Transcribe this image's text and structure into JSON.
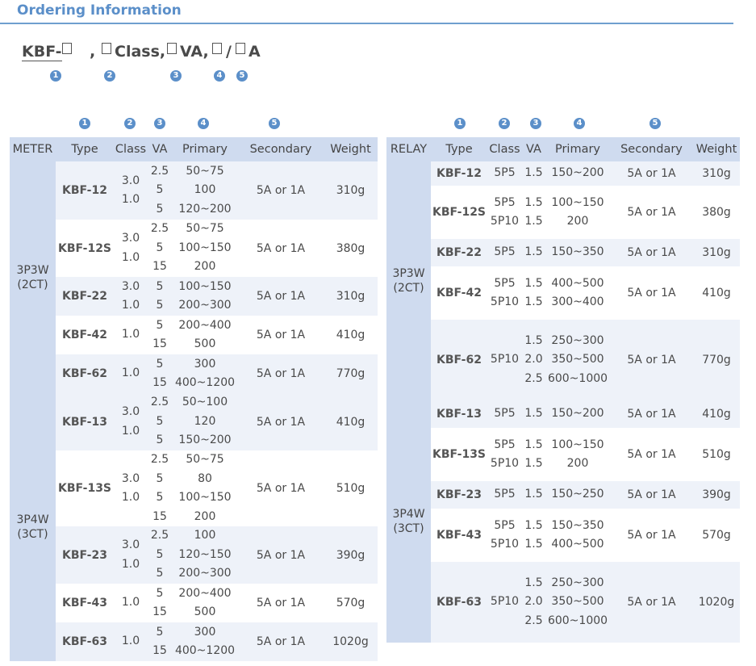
{
  "section_title": "Ordering Information",
  "code": {
    "prefix": "KBF-",
    "sep1": ",",
    "class": "Class,",
    "va": "VA,",
    "slash": "/",
    "a": "A"
  },
  "badges": [
    "1",
    "2",
    "3",
    "4",
    "5"
  ],
  "meter": {
    "headers": [
      "METER",
      "Type",
      "Class",
      "VA",
      "Primary",
      "Secondary",
      "Weight"
    ],
    "groups": [
      {
        "label_line1": "3P3W",
        "label_line2": "(2CT)",
        "rows": [
          {
            "type": "KBF-12",
            "class": [
              "3.0",
              "1.0"
            ],
            "va": [
              "2.5",
              "5",
              "5"
            ],
            "primary": [
              "50~75",
              "100",
              "120~200"
            ],
            "secondary": "5A or 1A",
            "weight": "310g"
          },
          {
            "type": "KBF-12S",
            "class": [
              "3.0",
              "1.0"
            ],
            "va": [
              "2.5",
              "5",
              "15"
            ],
            "primary": [
              "50~75",
              "100~150",
              "200"
            ],
            "secondary": "5A or 1A",
            "weight": "380g"
          },
          {
            "type": "KBF-22",
            "class": [
              "3.0",
              "1.0"
            ],
            "va": [
              "5",
              "5"
            ],
            "primary": [
              "100~150",
              "200~300"
            ],
            "secondary": "5A or 1A",
            "weight": "310g"
          },
          {
            "type": "KBF-42",
            "class": [
              "1.0"
            ],
            "va": [
              "5",
              "15"
            ],
            "primary": [
              "200~400",
              "500"
            ],
            "secondary": "5A or 1A",
            "weight": "410g"
          },
          {
            "type": "KBF-62",
            "class": [
              "1.0"
            ],
            "va": [
              "5",
              "15"
            ],
            "primary": [
              "300",
              "400~1200"
            ],
            "secondary": "5A or 1A",
            "weight": "770g"
          }
        ]
      },
      {
        "label_line1": "3P4W",
        "label_line2": "(3CT)",
        "rows": [
          {
            "type": "KBF-13",
            "class": [
              "3.0",
              "1.0"
            ],
            "va": [
              "2.5",
              "5",
              "5"
            ],
            "primary": [
              "50~100",
              "120",
              "150~200"
            ],
            "secondary": "5A or 1A",
            "weight": "410g"
          },
          {
            "type": "KBF-13S",
            "class": [
              "3.0",
              "1.0"
            ],
            "va": [
              "2.5",
              "5",
              "5",
              "15"
            ],
            "primary": [
              "50~75",
              "80",
              "100~150",
              "200"
            ],
            "secondary": "5A or 1A",
            "weight": "510g"
          },
          {
            "type": "KBF-23",
            "class": [
              "3.0",
              "1.0"
            ],
            "va": [
              "2.5",
              "5",
              "5"
            ],
            "primary": [
              "100",
              "120~150",
              "200~300"
            ],
            "secondary": "5A or 1A",
            "weight": "390g"
          },
          {
            "type": "KBF-43",
            "class": [
              "1.0"
            ],
            "va": [
              "5",
              "15"
            ],
            "primary": [
              "200~400",
              "500"
            ],
            "secondary": "5A or 1A",
            "weight": "570g"
          },
          {
            "type": "KBF-63",
            "class": [
              "1.0"
            ],
            "va": [
              "5",
              "15"
            ],
            "primary": [
              "300",
              "400~1200"
            ],
            "secondary": "5A or 1A",
            "weight": "1020g"
          }
        ]
      }
    ]
  },
  "relay": {
    "headers": [
      "RELAY",
      "Type",
      "Class",
      "VA",
      "Primary",
      "Secondary",
      "Weight"
    ],
    "groups": [
      {
        "label_line1": "3P3W",
        "label_line2": "(2CT)",
        "rows": [
          {
            "type": "KBF-12",
            "class": [
              "5P5"
            ],
            "va": [
              "1.5"
            ],
            "primary": [
              "150~200"
            ],
            "secondary": "5A or 1A",
            "weight": "310g"
          },
          {
            "type": "KBF-12S",
            "class": [
              "5P5",
              "5P10"
            ],
            "va": [
              "1.5",
              "1.5"
            ],
            "primary": [
              "100~150",
              "200"
            ],
            "secondary": "5A or 1A",
            "weight": "380g"
          },
          {
            "type": "KBF-22",
            "class": [
              "5P5"
            ],
            "va": [
              "1.5"
            ],
            "primary": [
              "150~350"
            ],
            "secondary": "5A or 1A",
            "weight": "310g"
          },
          {
            "type": "KBF-42",
            "class": [
              "5P5",
              "5P10"
            ],
            "va": [
              "1.5",
              "1.5"
            ],
            "primary": [
              "400~500",
              "300~400"
            ],
            "secondary": "5A or 1A",
            "weight": "410g"
          },
          {
            "type": "KBF-62",
            "class": [
              "5P10"
            ],
            "va": [
              "1.5",
              "2.0",
              "2.5"
            ],
            "primary": [
              "250~300",
              "350~500",
              "600~1000"
            ],
            "secondary": "5A or 1A",
            "weight": "770g"
          }
        ]
      },
      {
        "label_line1": "3P4W",
        "label_line2": "(3CT)",
        "rows": [
          {
            "type": "KBF-13",
            "class": [
              "5P5"
            ],
            "va": [
              "1.5"
            ],
            "primary": [
              "150~200"
            ],
            "secondary": "5A or 1A",
            "weight": "410g"
          },
          {
            "type": "KBF-13S",
            "class": [
              "5P5",
              "5P10"
            ],
            "va": [
              "1.5",
              "1.5"
            ],
            "primary": [
              "100~150",
              "200"
            ],
            "secondary": "5A or 1A",
            "weight": "510g"
          },
          {
            "type": "KBF-23",
            "class": [
              "5P5"
            ],
            "va": [
              "1.5"
            ],
            "primary": [
              "150~250"
            ],
            "secondary": "5A or 1A",
            "weight": "390g"
          },
          {
            "type": "KBF-43",
            "class": [
              "5P5",
              "5P10"
            ],
            "va": [
              "1.5",
              "1.5"
            ],
            "primary": [
              "150~350",
              "400~500"
            ],
            "secondary": "5A or 1A",
            "weight": "570g"
          },
          {
            "type": "KBF-63",
            "class": [
              "5P10"
            ],
            "va": [
              "1.5",
              "2.0",
              "2.5"
            ],
            "primary": [
              "250~300",
              "350~500",
              "600~1000"
            ],
            "secondary": "5A or 1A",
            "weight": "1020g"
          }
        ]
      }
    ]
  }
}
